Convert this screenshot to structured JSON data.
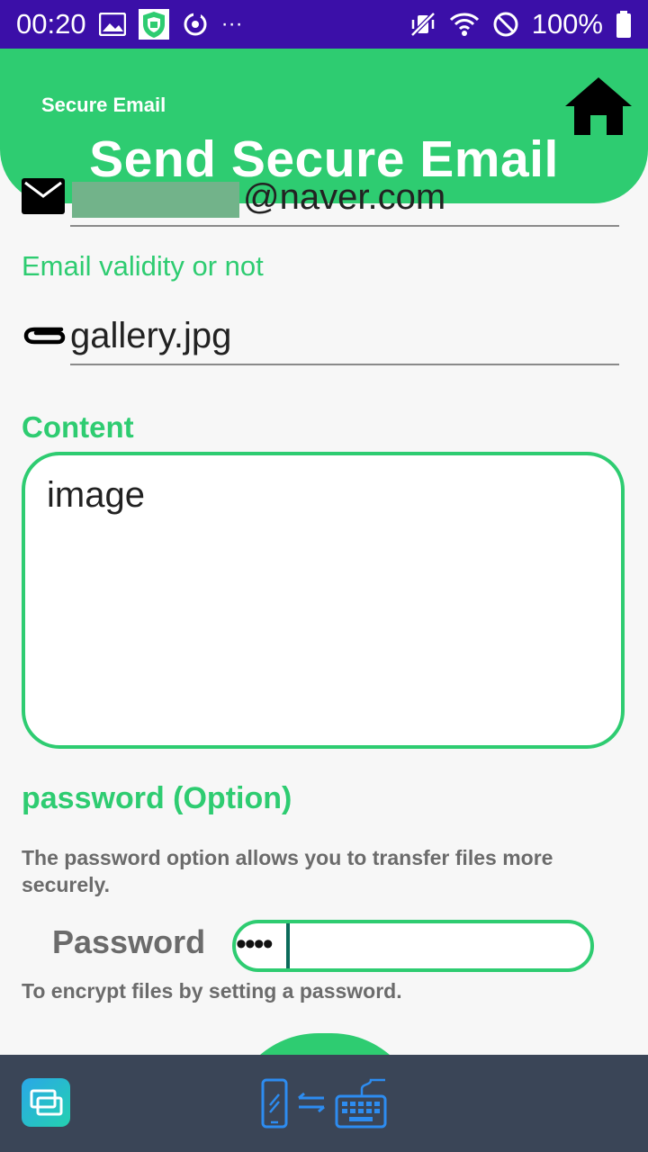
{
  "status_bar": {
    "time": "00:20",
    "more_indicator": "···",
    "battery": "100%",
    "left_icons": [
      "image-icon",
      "shield-app-icon",
      "sync-icon"
    ],
    "right_icons": [
      "mute-vibrate-icon",
      "wifi-icon",
      "block-icon",
      "battery-icon"
    ]
  },
  "header": {
    "app_title": "Secure Email",
    "page_title": "Send Secure Email",
    "home_icon": "home-icon"
  },
  "form": {
    "email_value": "@naver.com",
    "email_icon": "email-icon",
    "validity_text": "Email validity or not",
    "attachment_value": "gallery.jpg",
    "attachment_icon": "paperclip-icon",
    "content_label": "Content",
    "content_value": "image",
    "password_label": "password (Option)",
    "password_description": "The password option allows you to transfer files more securely.",
    "password_field_label": "Password",
    "password_value": "••••",
    "password_hint": "To encrypt files by setting a password."
  },
  "bottom_bar": {
    "app_icon": "screen-mirror-app-icon",
    "center_icon": "phone-keyboard-transfer-icon"
  },
  "colors": {
    "accent": "#2ecc71",
    "status_bar": "#3b0fa8",
    "bottom_bar": "#3a4557"
  }
}
